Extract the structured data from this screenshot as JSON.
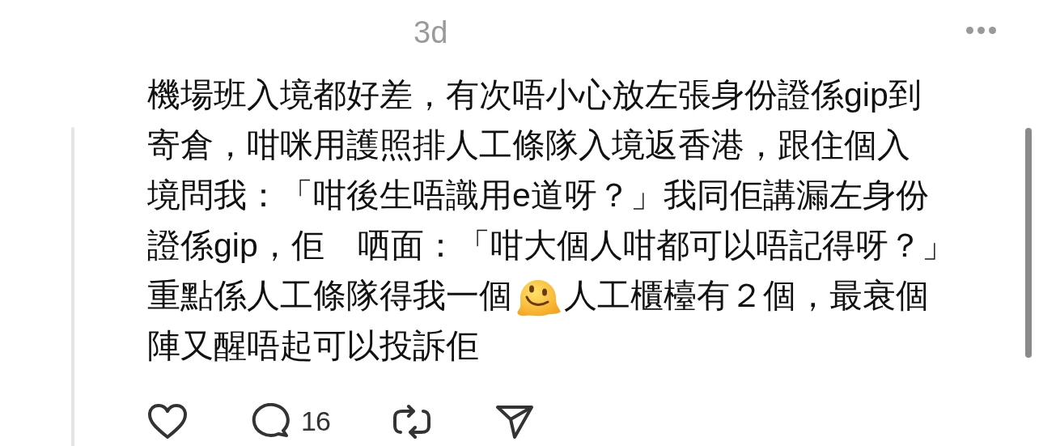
{
  "post": {
    "time": "3d",
    "lines": [
      {
        "text": "機場班入境都好差，有次唔小心放左張身份證係gip到"
      },
      {
        "text": "寄倉，咁咪用護照排人工條隊入境返香港，跟住個入"
      },
      {
        "text": "境問我：「咁後生唔識用e道呀？」我同佢講漏左身份"
      },
      {
        "text": "證係gip，佢　哂面：「咁大個人咁都可以唔記得呀？」"
      },
      {
        "text": "重點係人工條隊得我一個",
        "after_emoji": "人工櫃檯有２個，最衰個"
      },
      {
        "text": "陣又醒唔起可以投訴佢"
      }
    ],
    "reply_count": "16"
  }
}
